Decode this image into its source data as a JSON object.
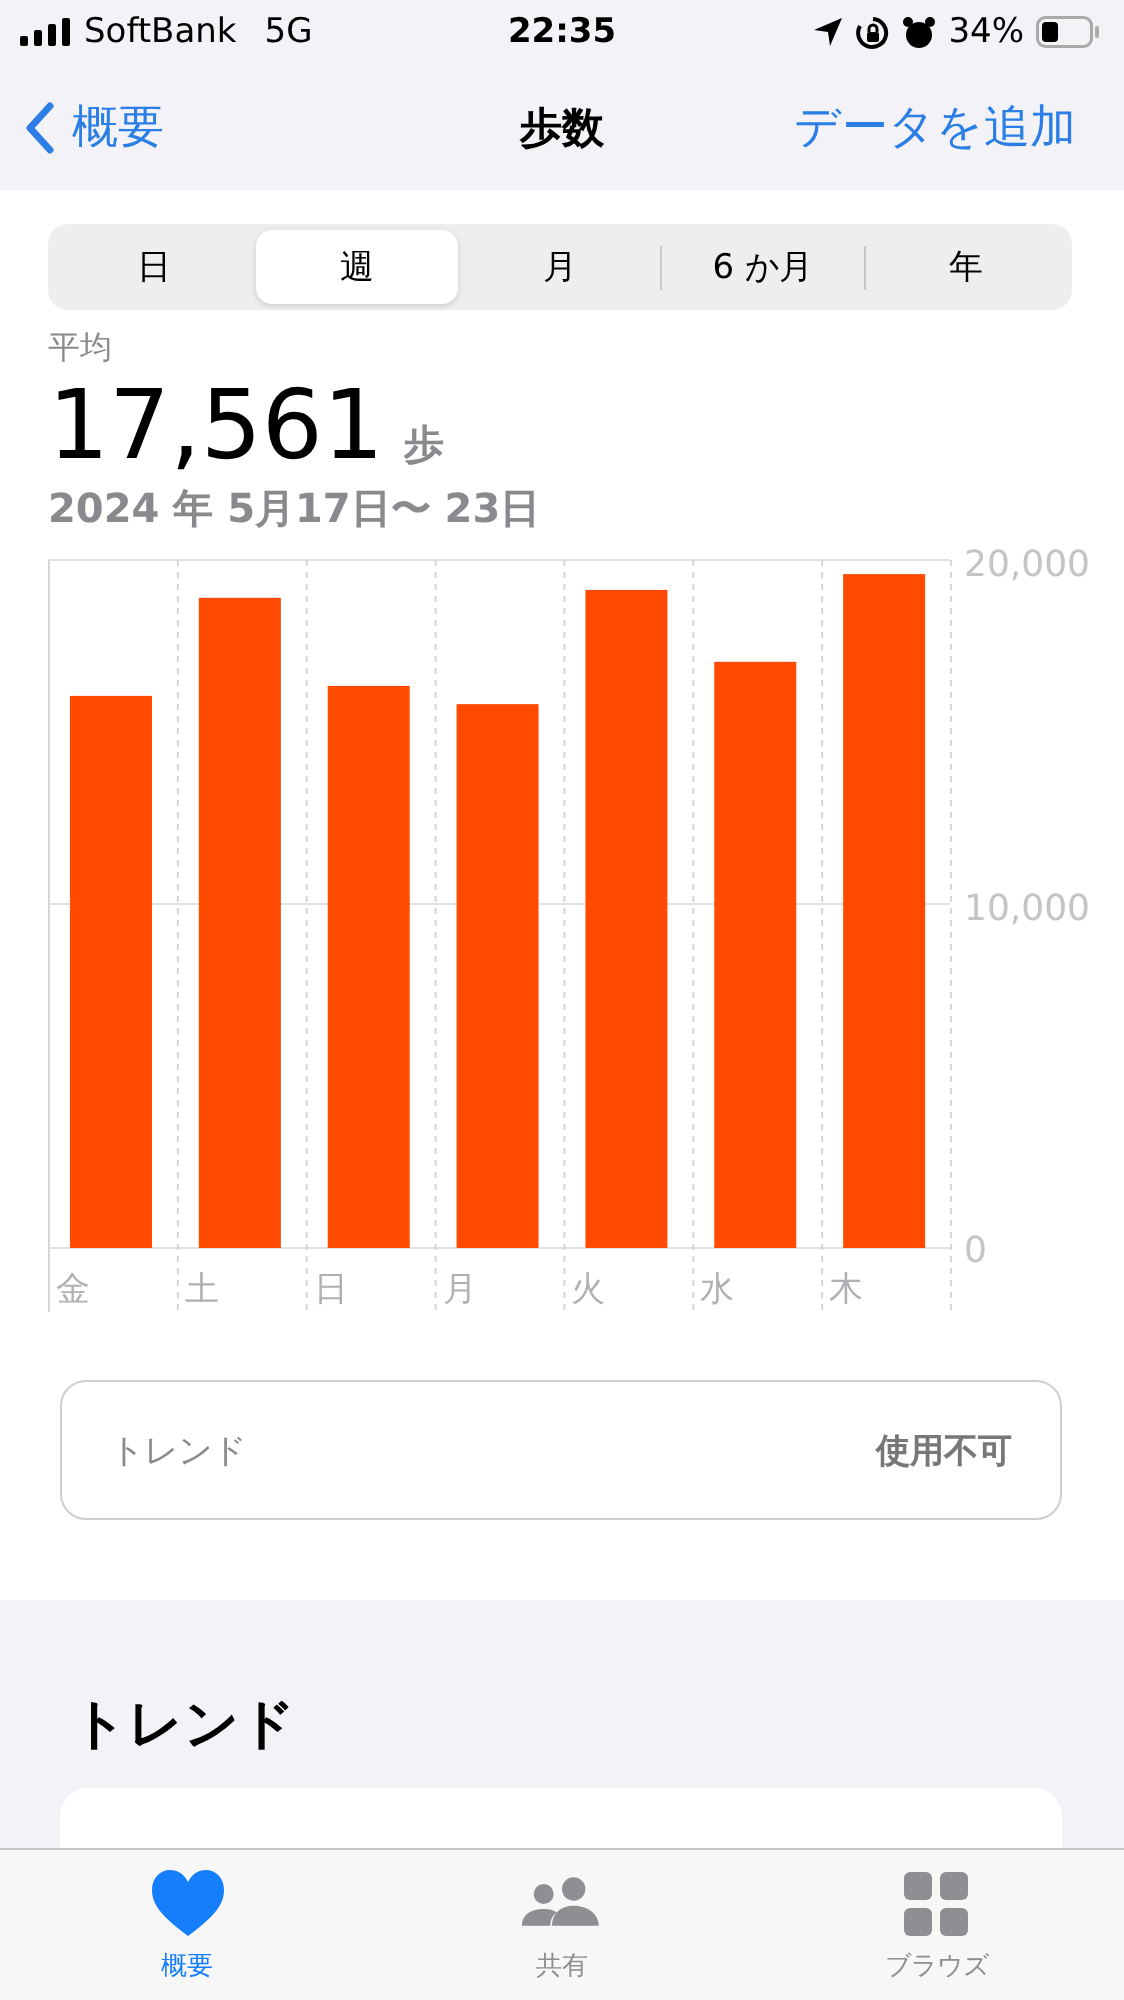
{
  "status_bar": {
    "carrier": "SoftBank",
    "network": "5G",
    "time": "22:35",
    "battery": "34%"
  },
  "nav": {
    "back": "概要",
    "title": "歩数",
    "action": "データを追加"
  },
  "range_tabs": [
    {
      "label": "日",
      "selected": false
    },
    {
      "label": "週",
      "selected": true
    },
    {
      "label": "月",
      "selected": false
    },
    {
      "label": "6 か月",
      "selected": false
    },
    {
      "label": "年",
      "selected": false
    }
  ],
  "summary": {
    "label": "平均",
    "value": "17,561",
    "unit": "歩",
    "range": "2024 年 5月17日〜 23日"
  },
  "chart_data": {
    "type": "bar",
    "categories": [
      "金",
      "土",
      "日",
      "月",
      "火",
      "水",
      "木"
    ],
    "series": [
      {
        "color": "#ff4a00",
        "values": [
          16050,
          18900,
          16340,
          15810,
          19130,
          17040,
          19590
        ]
      }
    ],
    "ylim": [
      0,
      20000
    ],
    "yticks": [
      {
        "value": 0,
        "label": "0"
      },
      {
        "value": 10000,
        "label": "10,000"
      },
      {
        "value": 20000,
        "label": "20,000"
      }
    ]
  },
  "trend_row": {
    "label": "トレンド",
    "value": "使用不可"
  },
  "trends_section": {
    "title": "トレンド"
  },
  "tab_bar": [
    {
      "label": "概要",
      "kind": "heart",
      "selected": true
    },
    {
      "label": "共有",
      "kind": "people",
      "selected": false
    },
    {
      "label": "ブラウズ",
      "kind": "grid",
      "selected": false
    }
  ]
}
